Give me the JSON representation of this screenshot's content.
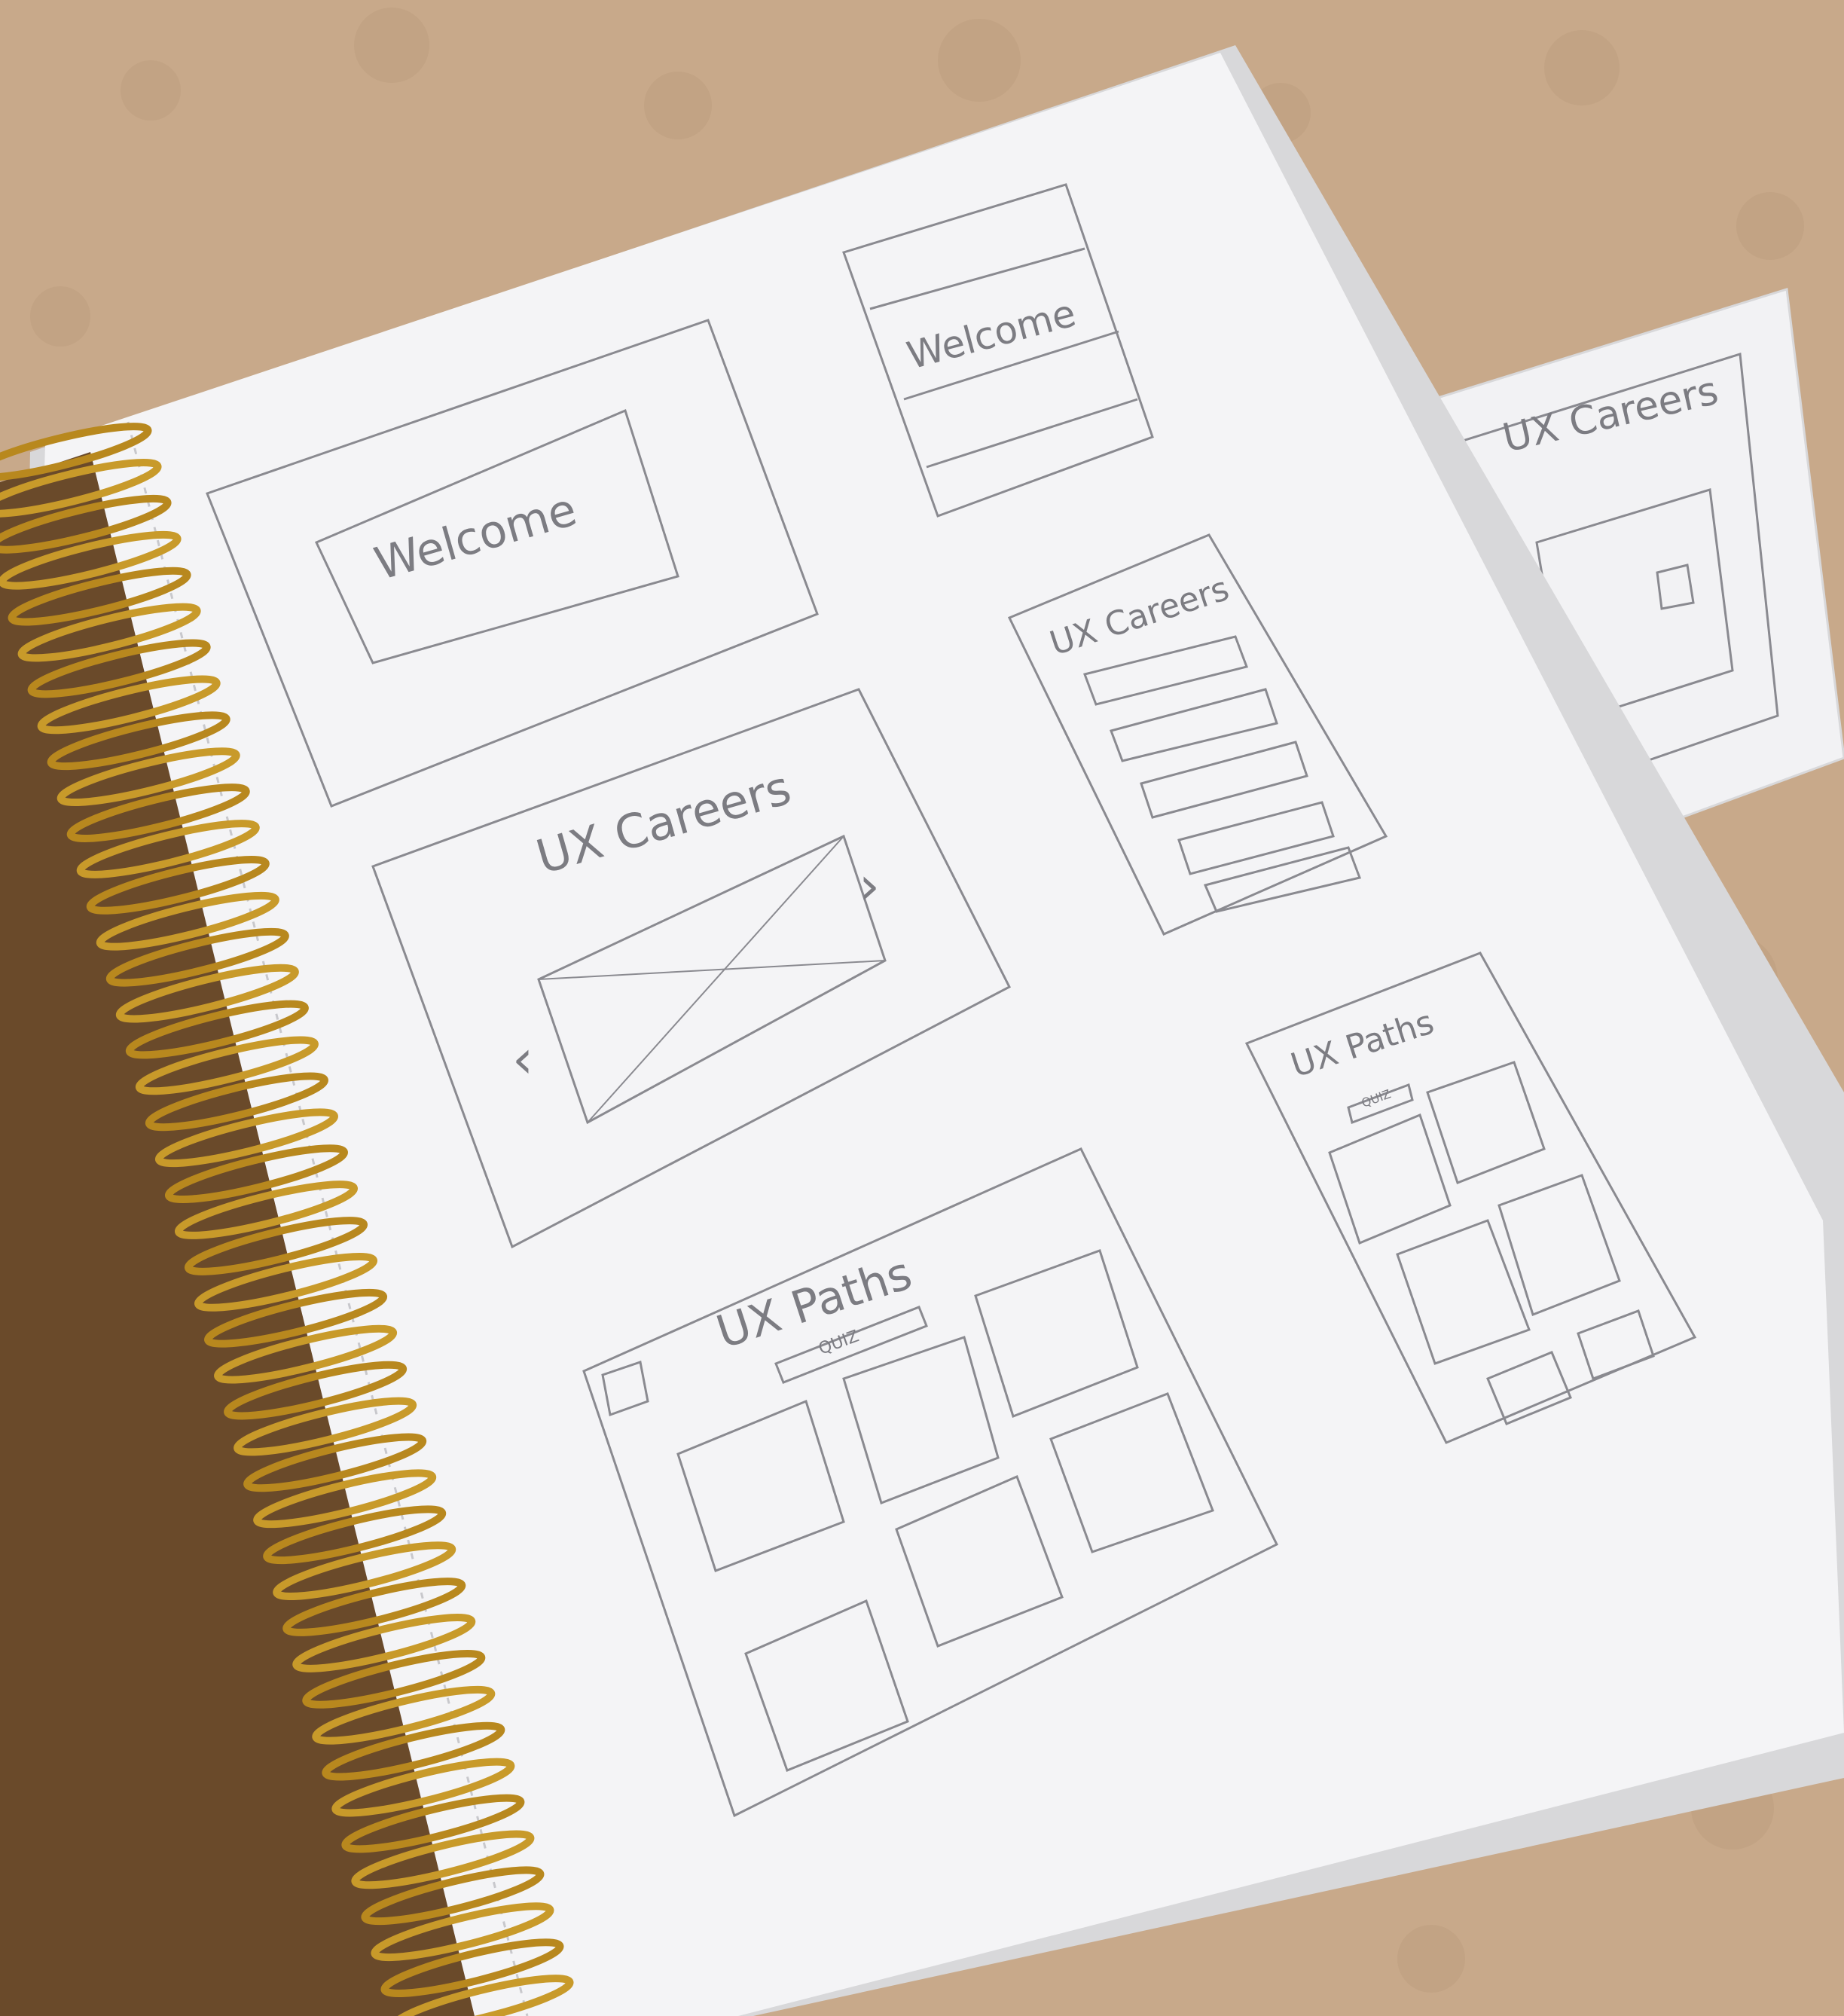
{
  "colors": {
    "carpet": "#c8a98a",
    "carpet_dark": "#b89878",
    "paper": "#f4f4f6",
    "paper_shadow": "#dcdcde",
    "pencil": "#7c7c82",
    "coil": "#c89a2a",
    "coil_dark": "#8a6418",
    "gutter": "#6a4a2a"
  },
  "sketches": {
    "welcome_desktop": "Welcome",
    "welcome_mobile": "Welcome",
    "careers_desktop": "UX Careers",
    "careers_mobile": "UX Careers",
    "careers_card": "UX Careers",
    "paths_desktop": "UX Paths",
    "paths_desktop_button": "QUIZ",
    "paths_mobile": "UX Paths",
    "paths_mobile_button": "QUIZ"
  }
}
